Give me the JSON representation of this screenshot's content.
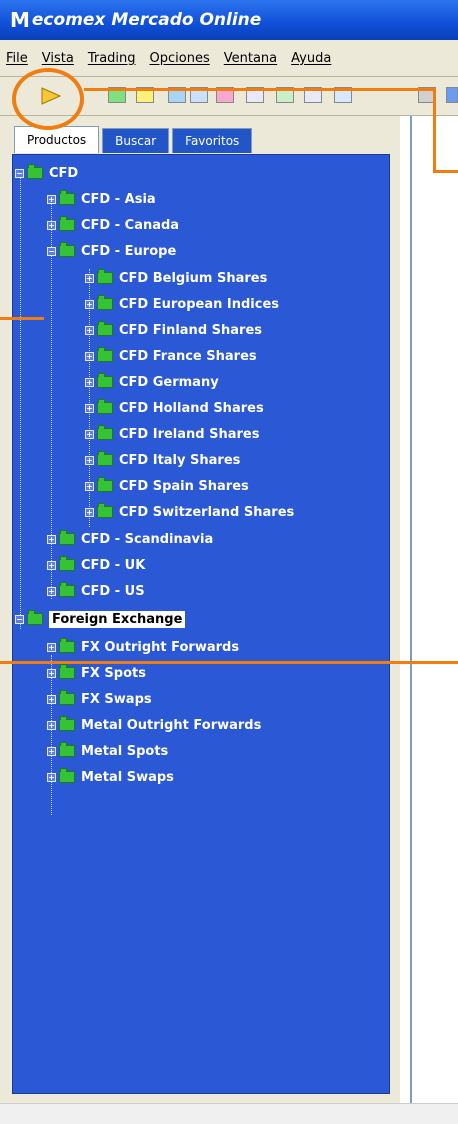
{
  "window": {
    "title": "ecomex Mercado Online",
    "logo_letter": "M"
  },
  "menu": [
    "File",
    "Vista",
    "Trading",
    "Opciones",
    "Ventana",
    "Ayuda"
  ],
  "tabs": [
    "Productos",
    "Buscar",
    "Favoritos"
  ],
  "tree": {
    "cfd": "CFD",
    "cfd_asia": "CFD - Asia",
    "cfd_canada": "CFD - Canada",
    "cfd_europe": "CFD - Europe",
    "europe_children": [
      "CFD Belgium Shares",
      "CFD European Indices",
      "CFD Finland Shares",
      "CFD France Shares",
      "CFD Germany",
      "CFD Holland Shares",
      "CFD Ireland Shares",
      "CFD Italy Shares",
      "CFD Spain Shares",
      "CFD Switzerland Shares"
    ],
    "cfd_scandinavia": "CFD - Scandinavia",
    "cfd_uk": "CFD - UK",
    "cfd_us": "CFD - US",
    "forex": "Foreign Exchange",
    "forex_children": [
      "FX Outright Forwards",
      "FX Spots",
      "FX Swaps",
      "Metal Outright Forwards",
      "Metal Spots",
      "Metal Swaps"
    ]
  },
  "colors": {
    "tree_bg": "#2b58d4",
    "accent_annotation": "#ef7d10",
    "folder": "#35c335"
  },
  "icons": {
    "toolbar_open": "open-arrow-icon",
    "folder": "folder-icon"
  }
}
